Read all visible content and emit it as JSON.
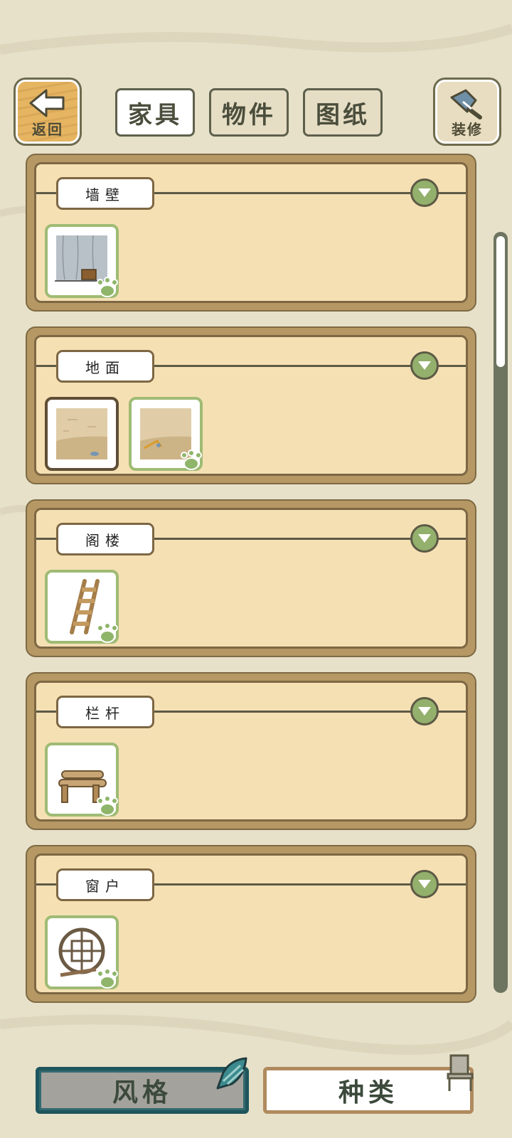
{
  "header": {
    "back": {
      "label": "返回",
      "icon": "back-arrow-icon"
    },
    "decorate": {
      "label": "装修",
      "icon": "paint-brush-icon"
    },
    "tabs": [
      {
        "label": "家具",
        "active": true
      },
      {
        "label": "物件",
        "active": false
      },
      {
        "label": "图纸",
        "active": false
      }
    ]
  },
  "sections": [
    {
      "title": "墙壁",
      "items": [
        {
          "thumb": "wall-icon",
          "selected": false
        }
      ]
    },
    {
      "title": "地面",
      "items": [
        {
          "thumb": "floor-icon",
          "selected": true
        },
        {
          "thumb": "floor-icon",
          "selected": false
        }
      ]
    },
    {
      "title": "阁楼",
      "items": [
        {
          "thumb": "ladder-icon",
          "selected": false
        }
      ]
    },
    {
      "title": "栏杆",
      "items": [
        {
          "thumb": "log-railing-icon",
          "selected": false
        }
      ]
    },
    {
      "title": "窗户",
      "items": [
        {
          "thumb": "round-window-icon",
          "selected": false
        }
      ]
    }
  ],
  "footer": {
    "style_label": "风格",
    "kind_label": "种类"
  },
  "colors": {
    "background": "#e7e1c9",
    "panel": "#f5e0b4",
    "frame": "#b59864",
    "accent_green": "#9fbb74",
    "dark_teal": "#1f555c"
  }
}
